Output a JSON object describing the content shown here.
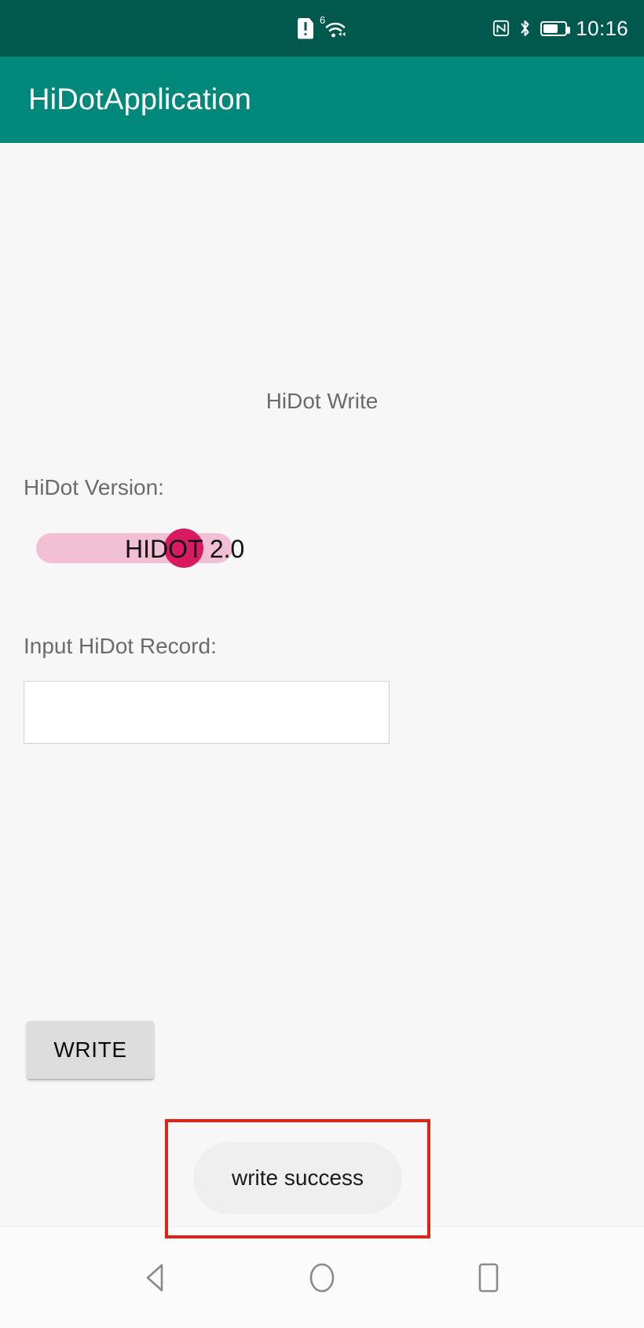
{
  "status_bar": {
    "time": "10:16",
    "icons": [
      "sim-card-alert-icon",
      "wifi-6-icon",
      "nfc-icon",
      "bluetooth-icon",
      "battery-icon"
    ],
    "wifi_generation": "6",
    "background_color": "#00594c"
  },
  "app_bar": {
    "title": "HiDotApplication",
    "background_color": "#00897b"
  },
  "main": {
    "screen_title": "HiDot Write",
    "version_label": "HiDot Version:",
    "version_slider": {
      "value_text": "HIDOT 2.0",
      "track_color": "#f3bfd5",
      "thumb_color": "#d81b60"
    },
    "record_label": "Input HiDot Record:",
    "record_input_value": "",
    "record_input_placeholder": "",
    "write_button_label": "WRITE",
    "toast_message": "write success",
    "annotation_color": "#e32119"
  },
  "nav_bar": {
    "back_label": "back-icon",
    "home_label": "home-icon",
    "recents_label": "recents-icon"
  }
}
